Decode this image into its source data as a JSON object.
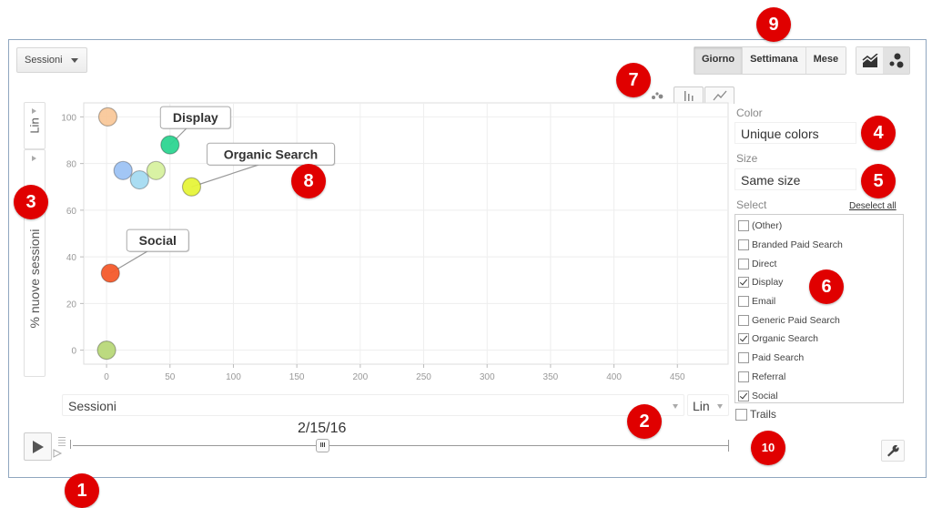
{
  "toolbar": {
    "metric_dropdown": "Sessioni",
    "period_buttons": [
      {
        "label": "Giorno",
        "active": true
      },
      {
        "label": "Settimana",
        "active": false
      },
      {
        "label": "Mese",
        "active": false
      }
    ],
    "view_buttons": [
      {
        "icon": "line-chart-icon",
        "active": false
      },
      {
        "icon": "bubble-chart-icon",
        "active": true
      }
    ],
    "chart_type_tabs": [
      {
        "icon": "bubble-chart-icon",
        "active": true
      },
      {
        "icon": "bar-chart-icon",
        "active": false
      },
      {
        "icon": "line-chart-icon",
        "active": false
      }
    ]
  },
  "y_axis_controls": {
    "scale": "Lin",
    "metric": "% nuove sessioni"
  },
  "x_axis_controls": {
    "metric": "Sessioni",
    "scale": "Lin"
  },
  "side_panel": {
    "color_label": "Color",
    "color_value": "Unique colors",
    "size_label": "Size",
    "size_value": "Same size",
    "select_label": "Select",
    "deselect_all": "Deselect all",
    "items": [
      {
        "label": "(Other)",
        "checked": false
      },
      {
        "label": "Branded Paid Search",
        "checked": false
      },
      {
        "label": "Direct",
        "checked": false
      },
      {
        "label": "Display",
        "checked": true
      },
      {
        "label": "Email",
        "checked": false
      },
      {
        "label": "Generic Paid Search",
        "checked": false
      },
      {
        "label": "Organic Search",
        "checked": true
      },
      {
        "label": "Paid Search",
        "checked": false
      },
      {
        "label": "Referral",
        "checked": false
      },
      {
        "label": "Social",
        "checked": true
      }
    ],
    "trails_label": "Trails",
    "trails_checked": false
  },
  "playback": {
    "date": "2/15/16",
    "play_icon": "play-icon",
    "settings_icon": "wrench-icon"
  },
  "annotations": [
    "1",
    "2",
    "3",
    "4",
    "5",
    "6",
    "7",
    "8",
    "9",
    "10"
  ],
  "chart_data": {
    "type": "scatter",
    "title": "",
    "xlabel": "Sessioni",
    "ylabel": "% nuove sessioni",
    "xlim": [
      -18,
      490
    ],
    "ylim": [
      -6,
      106
    ],
    "x_ticks": [
      0,
      50,
      100,
      150,
      200,
      250,
      300,
      350,
      400,
      450
    ],
    "y_ticks": [
      0,
      20,
      40,
      60,
      80,
      100
    ],
    "grid": true,
    "points": [
      {
        "name": "(Other)",
        "x": 1,
        "y": 100,
        "color": "#f9c99a",
        "label": false
      },
      {
        "name": "Display",
        "x": 50,
        "y": 88,
        "color": "#2ed592",
        "label": true
      },
      {
        "name": "Branded Paid Search",
        "x": 13,
        "y": 77,
        "color": "#9ec3f5",
        "label": false
      },
      {
        "name": "Email",
        "x": 26,
        "y": 73,
        "color": "#a6dcf2",
        "label": false
      },
      {
        "name": "Generic Paid Search",
        "x": 39,
        "y": 77,
        "color": "#d8f2a0",
        "label": false
      },
      {
        "name": "Organic Search",
        "x": 67,
        "y": 70,
        "color": "#e6f53a",
        "label": true
      },
      {
        "name": "Social",
        "x": 3,
        "y": 33,
        "color": "#f55a2c",
        "label": true
      },
      {
        "name": "Direct",
        "x": 0,
        "y": 0,
        "color": "#b9d97a",
        "label": false
      }
    ]
  }
}
